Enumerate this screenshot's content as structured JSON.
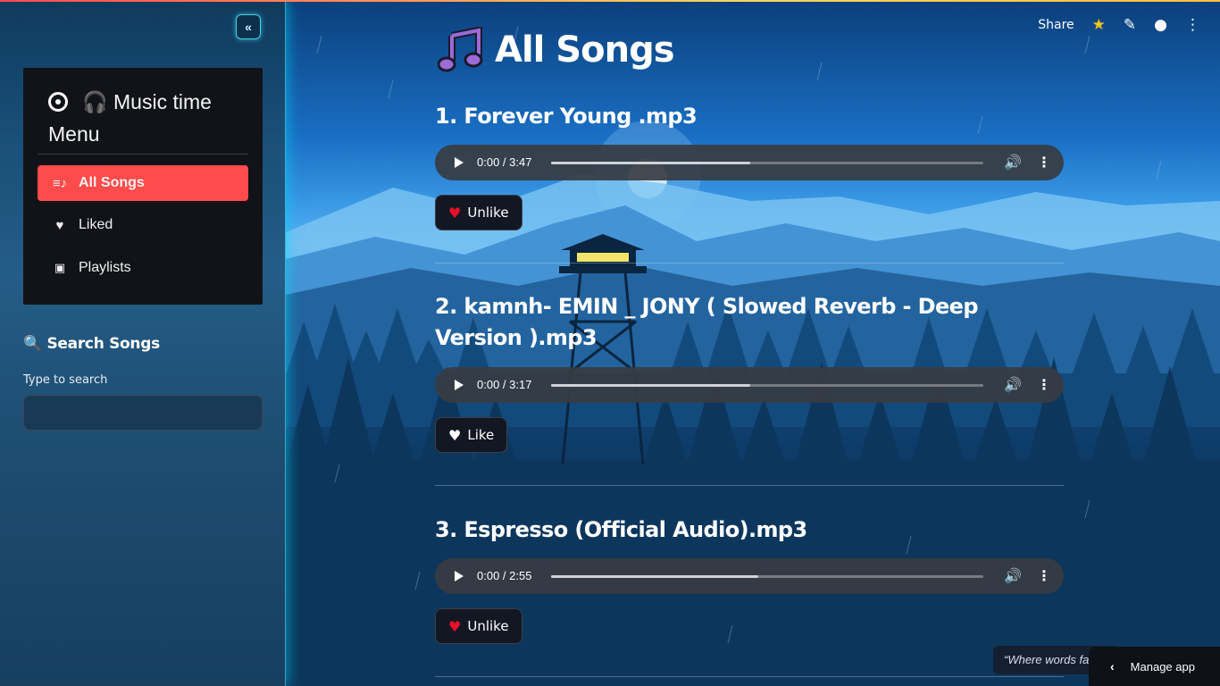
{
  "sidebar": {
    "collapse_label": "«",
    "menu": {
      "title_line1": "🎧 Music time",
      "title_line2": "Menu",
      "items": [
        {
          "label": "All Songs",
          "icon": "playlist-icon",
          "active": true
        },
        {
          "label": "Liked",
          "icon": "heart-icon",
          "active": false
        },
        {
          "label": "Playlists",
          "icon": "speaker-icon",
          "active": false
        }
      ]
    },
    "search": {
      "heading": "🔍 Search Songs",
      "label": "Type to search",
      "value": "",
      "placeholder": ""
    }
  },
  "toolbar": {
    "share_label": "Share"
  },
  "main": {
    "title": "All Songs",
    "songs": [
      {
        "title": "1. Forever Young .mp3",
        "time": "0:00 / 3:47",
        "button": "Unlike",
        "liked": true,
        "progress": 0.46
      },
      {
        "title": "2. kamnh- EMIN _ JONY ( Slowed Reverb - Deep Version ).mp3",
        "time": "0:00 / 3:17",
        "button": "Like",
        "liked": false,
        "progress": 0.46
      },
      {
        "title": "3. Espresso (Official Audio).mp3",
        "time": "0:00 / 2:55",
        "button": "Unlike",
        "liked": true,
        "progress": 0.48
      }
    ]
  },
  "footer": {
    "quote": "“Where words fa",
    "manage_label": "Manage app"
  },
  "colors": {
    "accent": "#ff4b4b",
    "heart_red": "#e8102a",
    "star": "#f5c518"
  }
}
